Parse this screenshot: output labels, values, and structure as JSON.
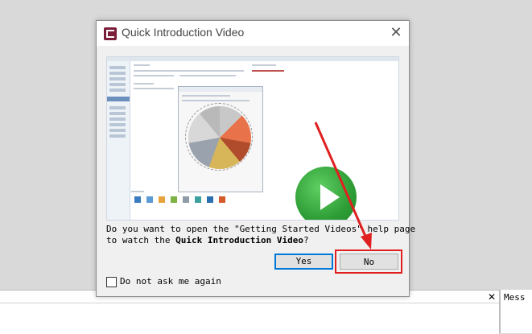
{
  "dialog": {
    "title": "Quick Introduction Video",
    "close_glyph": "✕",
    "message_line1": "Do you want to open the \"Getting Started Videos\" help page",
    "message_line2_prefix": "to watch the ",
    "message_line2_bold": "Quick Introduction Video",
    "message_line2_suffix": "?",
    "yes_label": "Yes",
    "no_label": "No",
    "checkbox_label": "Do not ask me again",
    "checkbox_checked": false
  },
  "background": {
    "panel_close_glyph": "✕",
    "right_panel_label": "Mess"
  },
  "colors": {
    "play_button": "#2d9c35",
    "annotation_red": "#e02020",
    "default_button_border": "#0078d7"
  }
}
